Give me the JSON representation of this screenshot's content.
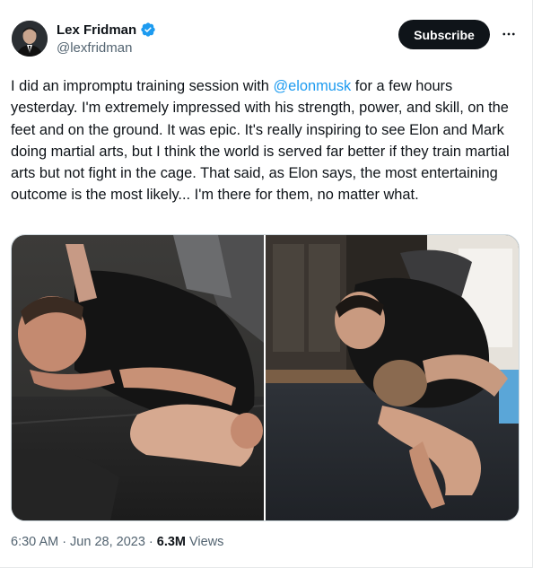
{
  "author": {
    "name": "Lex Fridman",
    "handle": "@lexfridman",
    "avatar_icon": "profile-photo",
    "verified_icon": "verified-badge-icon"
  },
  "actions": {
    "subscribe_label": "Subscribe",
    "more_icon": "more-options-icon"
  },
  "tweet": {
    "text_before_mention": "I did an impromptu training session with ",
    "mention": "@elonmusk",
    "text_after_mention": " for a few hours yesterday. I'm extremely impressed with his strength, power, and skill, on the feet and on the ground. It was epic. It's really inspiring to see Elon and Mark doing martial arts, but I think the world is served far better if they train martial arts but not fight in the cage. That said, as Elon says, the most entertaining outcome is the most likely... I'm there for them, no matter what."
  },
  "media": {
    "photos": [
      "training-photo-1",
      "training-photo-2"
    ]
  },
  "meta": {
    "time": "6:30 AM",
    "separator1": "·",
    "date": "Jun 28, 2023",
    "separator2": "·",
    "views_count": "6.3M",
    "views_label": "Views"
  },
  "colors": {
    "text": "#0f1419",
    "secondary": "#536471",
    "link": "#1d9bf0",
    "verified": "#1d9bf0",
    "button_bg": "#0f1419"
  }
}
